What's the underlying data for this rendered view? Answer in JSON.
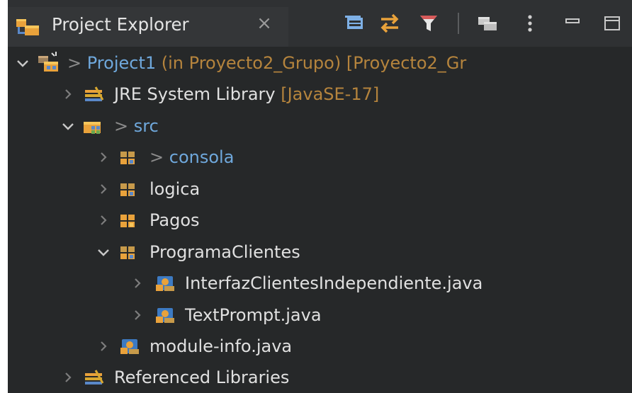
{
  "view": {
    "title": "Project Explorer",
    "close_symbol": "×",
    "toolbar": [
      {
        "name": "collapse-all-button",
        "icon": "collapse-all-icon"
      },
      {
        "name": "link-with-editor-button",
        "icon": "link-editor-icon"
      },
      {
        "name": "filter-button",
        "icon": "filter-icon"
      },
      {
        "name": "project-structure-button",
        "icon": "folders-icon"
      },
      {
        "name": "view-menu-button",
        "icon": "kebab-menu-icon"
      },
      {
        "name": "minimize-button",
        "icon": "minimize-icon"
      },
      {
        "name": "maximize-button",
        "icon": "maximize-icon"
      }
    ]
  },
  "tree": {
    "project": {
      "prefix": "> ",
      "name": "Project1",
      "decoration": " (in Proyecto2_Grupo) [Proyecto2_Gr"
    },
    "jre": {
      "name": "JRE System Library",
      "decoration": " [JavaSE-17]"
    },
    "src": {
      "prefix": "> ",
      "name": "src"
    },
    "consola": {
      "prefix": "> ",
      "name": "consola"
    },
    "logica": {
      "name": "logica"
    },
    "pagos": {
      "name": "Pagos"
    },
    "programa_clientes": {
      "name": "ProgramaClientes"
    },
    "interfaz": {
      "name": "InterfazClientesIndependiente.java"
    },
    "textprompt": {
      "name": "TextPrompt.java"
    },
    "module_info": {
      "name": "module-info.java"
    },
    "referenced": {
      "name": "Referenced Libraries"
    }
  },
  "colors": {
    "panel_bg": "#262829",
    "text": "#e0e0e0",
    "muted": "#8b8b8b",
    "decoration_orange": "#b5843d",
    "modified_blue": "#6fa8dc"
  }
}
